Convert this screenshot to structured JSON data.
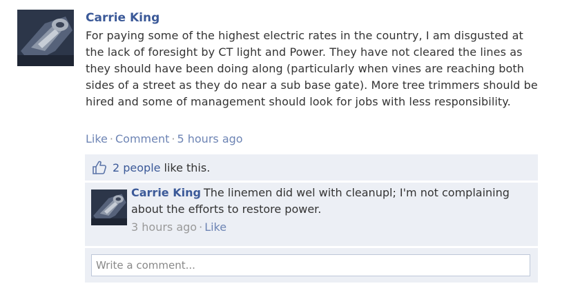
{
  "post": {
    "author": "Carrie King",
    "text": "For paying some of the highest electric rates in the country, I am disgusted at the lack of foresight by CT light and Power. They have not cleared the lines as they should have been doing along (particularly when vines are reaching both sides of a street as they do near a sub base gate). More tree trimmers should be hired and some of management should look for jobs with less responsibility.",
    "actions": {
      "like": "Like",
      "comment": "Comment",
      "timestamp": "5 hours ago",
      "separator": "·"
    }
  },
  "likes": {
    "people": "2 people",
    "suffix": "like this.",
    "icon": "thumbs-up-icon"
  },
  "comments": [
    {
      "author": "Carrie King",
      "text": "The linemen did wel with cleanupl; I'm not complaining about the efforts to restore power.",
      "timestamp": "3 hours ago",
      "like": "Like"
    }
  ],
  "write_comment": {
    "placeholder": "Write a comment..."
  },
  "colors": {
    "link": "#3b5998",
    "muted_link": "#6d84b4",
    "panel": "#eceff5",
    "meta": "#999999"
  }
}
